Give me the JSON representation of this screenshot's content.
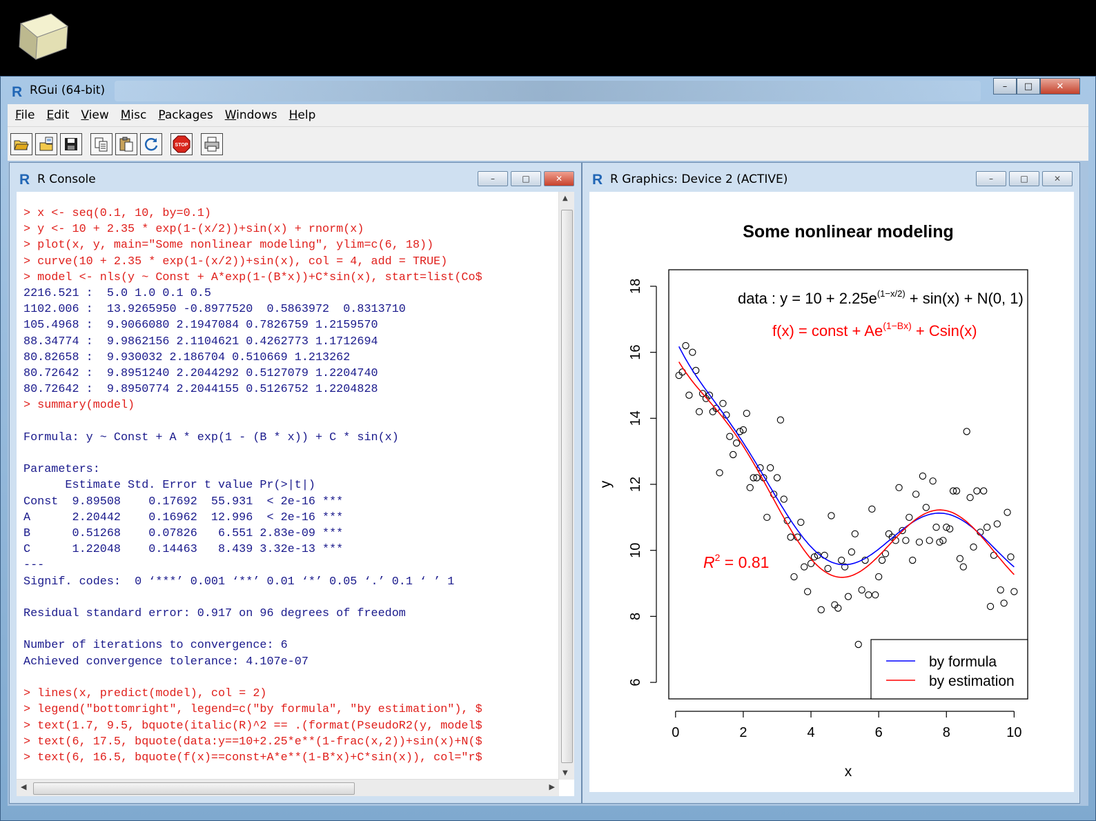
{
  "app": {
    "title": "RGui (64-bit)",
    "window_controls": {
      "minimize": "–",
      "maximize": "□",
      "close": "✕"
    }
  },
  "menu": [
    {
      "key": "F",
      "rest": "ile"
    },
    {
      "key": "E",
      "rest": "dit"
    },
    {
      "key": "V",
      "rest": "iew"
    },
    {
      "key": "M",
      "rest": "isc"
    },
    {
      "key": "P",
      "rest": "ackages"
    },
    {
      "key": "W",
      "rest": "indows"
    },
    {
      "key": "H",
      "rest": "elp"
    }
  ],
  "toolbar_icons": [
    "open-script-icon",
    "load-workspace-icon",
    "save-workspace-icon",
    "copy-icon",
    "paste-icon",
    "refresh-icon",
    "stop-icon",
    "print-icon"
  ],
  "console": {
    "title": "R Console",
    "lines": [
      {
        "t": "in",
        "s": "> x <- seq(0.1, 10, by=0.1)"
      },
      {
        "t": "in",
        "s": "> y <- 10 + 2.35 * exp(1-(x/2))+sin(x) + rnorm(x)"
      },
      {
        "t": "in",
        "s": "> plot(x, y, main=\"Some nonlinear modeling\", ylim=c(6, 18))"
      },
      {
        "t": "in",
        "s": "> curve(10 + 2.35 * exp(1-(x/2))+sin(x), col = 4, add = TRUE)"
      },
      {
        "t": "in",
        "s": "> model <- nls(y ~ Const + A*exp(1-(B*x))+C*sin(x), start=list(Co$"
      },
      {
        "t": "out",
        "s": "2216.521 :  5.0 1.0 0.1 0.5"
      },
      {
        "t": "out",
        "s": "1102.006 :  13.9265950 -0.8977520  0.5863972  0.8313710"
      },
      {
        "t": "out",
        "s": "105.4968 :  9.9066080 2.1947084 0.7826759 1.2159570"
      },
      {
        "t": "out",
        "s": "88.34774 :  9.9862156 2.1104621 0.4262773 1.1712694"
      },
      {
        "t": "out",
        "s": "80.82658 :  9.930032 2.186704 0.510669 1.213262"
      },
      {
        "t": "out",
        "s": "80.72642 :  9.8951240 2.2044292 0.5127079 1.2204740"
      },
      {
        "t": "out",
        "s": "80.72642 :  9.8950774 2.2044155 0.5126752 1.2204828"
      },
      {
        "t": "in",
        "s": "> summary(model)"
      },
      {
        "t": "out",
        "s": ""
      },
      {
        "t": "out",
        "s": "Formula: y ~ Const + A * exp(1 - (B * x)) + C * sin(x)"
      },
      {
        "t": "out",
        "s": ""
      },
      {
        "t": "out",
        "s": "Parameters:"
      },
      {
        "t": "out",
        "s": "      Estimate Std. Error t value Pr(>|t|)    "
      },
      {
        "t": "out",
        "s": "Const  9.89508    0.17692  55.931  < 2e-16 ***"
      },
      {
        "t": "out",
        "s": "A      2.20442    0.16962  12.996  < 2e-16 ***"
      },
      {
        "t": "out",
        "s": "B      0.51268    0.07826   6.551 2.83e-09 ***"
      },
      {
        "t": "out",
        "s": "C      1.22048    0.14463   8.439 3.32e-13 ***"
      },
      {
        "t": "out",
        "s": "---"
      },
      {
        "t": "out",
        "s": "Signif. codes:  0 ‘***’ 0.001 ‘**’ 0.01 ‘*’ 0.05 ‘.’ 0.1 ‘ ’ 1"
      },
      {
        "t": "out",
        "s": ""
      },
      {
        "t": "out",
        "s": "Residual standard error: 0.917 on 96 degrees of freedom"
      },
      {
        "t": "out",
        "s": ""
      },
      {
        "t": "out",
        "s": "Number of iterations to convergence: 6 "
      },
      {
        "t": "out",
        "s": "Achieved convergence tolerance: 4.107e-07"
      },
      {
        "t": "out",
        "s": ""
      },
      {
        "t": "in",
        "s": "> lines(x, predict(model), col = 2)"
      },
      {
        "t": "in",
        "s": "> legend(\"bottomright\", legend=c(\"by formula\", \"by estimation\"), $"
      },
      {
        "t": "in",
        "s": "> text(1.7, 9.5, bquote(italic(R)^2 == .(format(PseudoR2(y, model$"
      },
      {
        "t": "in",
        "s": "> text(6, 17.5, bquote(data:y==10+2.25*e**(1-frac(x,2))+sin(x)+N($"
      },
      {
        "t": "in",
        "s": "> text(6, 16.5, bquote(f(x)==const+A*e**(1-B*x)+C*sin(x)), col=\"r$"
      }
    ]
  },
  "graphics": {
    "title": "R Graphics: Device 2 (ACTIVE)"
  },
  "chart_data": {
    "type": "scatter",
    "title": "Some nonlinear modeling",
    "xlabel": "x",
    "ylabel": "y",
    "xlim": [
      0,
      10
    ],
    "ylim": [
      6,
      18
    ],
    "xticks": [
      "0",
      "2",
      "4",
      "6",
      "8",
      "10"
    ],
    "yticks": [
      "6",
      "8",
      "10",
      "12",
      "14",
      "16",
      "18"
    ],
    "annotations": {
      "data_formula": {
        "prefix": "data : y = 10 + 2.25e",
        "exponent": "(1−x/2)",
        "suffix": " + sin(x) + N(0, 1)"
      },
      "fit_formula": {
        "prefix": "f(x) = const + Ae",
        "exponent": "(1−Bx)",
        "suffix": " + Csin(x)"
      },
      "r2": {
        "label": "R",
        "power": "2",
        "value": " = 0.81"
      }
    },
    "legend": {
      "position": "bottom-right",
      "entries": [
        {
          "name": "by formula",
          "color": "#0000ff"
        },
        {
          "name": "by estimation",
          "color": "#ff0000"
        }
      ]
    },
    "curves": {
      "formula": {
        "Const": 10,
        "A": 2.35,
        "B": 0.5,
        "C": 1,
        "color": "#0000ff"
      },
      "estimation": {
        "Const": 9.89508,
        "A": 2.20442,
        "B": 0.51268,
        "C": 1.22048,
        "color": "#ff0000"
      }
    },
    "points": [
      [
        0.1,
        15.3
      ],
      [
        0.2,
        15.4
      ],
      [
        0.3,
        16.2
      ],
      [
        0.4,
        14.7
      ],
      [
        0.5,
        16.0
      ],
      [
        0.6,
        15.45
      ],
      [
        0.7,
        14.2
      ],
      [
        0.8,
        14.75
      ],
      [
        0.9,
        14.6
      ],
      [
        1.0,
        14.7
      ],
      [
        1.1,
        14.2
      ],
      [
        1.2,
        14.3
      ],
      [
        1.3,
        12.35
      ],
      [
        1.4,
        14.45
      ],
      [
        1.5,
        14.1
      ],
      [
        1.6,
        13.45
      ],
      [
        1.7,
        12.9
      ],
      [
        1.8,
        13.25
      ],
      [
        1.9,
        13.6
      ],
      [
        2.0,
        13.65
      ],
      [
        2.1,
        14.15
      ],
      [
        2.2,
        11.9
      ],
      [
        2.3,
        12.2
      ],
      [
        2.4,
        12.2
      ],
      [
        2.5,
        12.5
      ],
      [
        2.6,
        12.2
      ],
      [
        2.7,
        11.0
      ],
      [
        2.8,
        12.5
      ],
      [
        2.9,
        11.7
      ],
      [
        3.0,
        12.2
      ],
      [
        3.1,
        13.95
      ],
      [
        3.2,
        11.55
      ],
      [
        3.3,
        10.9
      ],
      [
        3.4,
        10.4
      ],
      [
        3.5,
        9.2
      ],
      [
        3.6,
        10.4
      ],
      [
        3.7,
        10.85
      ],
      [
        3.8,
        9.5
      ],
      [
        3.9,
        8.75
      ],
      [
        4.0,
        9.6
      ],
      [
        4.1,
        9.8
      ],
      [
        4.2,
        9.85
      ],
      [
        4.3,
        8.2
      ],
      [
        4.4,
        9.85
      ],
      [
        4.5,
        9.45
      ],
      [
        4.6,
        11.05
      ],
      [
        4.7,
        8.35
      ],
      [
        4.8,
        8.25
      ],
      [
        4.9,
        9.7
      ],
      [
        5.0,
        9.5
      ],
      [
        5.1,
        8.6
      ],
      [
        5.2,
        9.95
      ],
      [
        5.3,
        10.5
      ],
      [
        5.4,
        7.15
      ],
      [
        5.5,
        8.8
      ],
      [
        5.6,
        9.7
      ],
      [
        5.7,
        8.65
      ],
      [
        5.8,
        11.25
      ],
      [
        5.9,
        8.65
      ],
      [
        6.0,
        9.2
      ],
      [
        6.1,
        9.7
      ],
      [
        6.2,
        9.9
      ],
      [
        6.3,
        10.5
      ],
      [
        6.4,
        10.4
      ],
      [
        6.5,
        10.3
      ],
      [
        6.6,
        11.9
      ],
      [
        6.7,
        10.6
      ],
      [
        6.8,
        10.3
      ],
      [
        6.9,
        11.0
      ],
      [
        7.0,
        9.7
      ],
      [
        7.1,
        11.7
      ],
      [
        7.2,
        10.25
      ],
      [
        7.3,
        12.25
      ],
      [
        7.4,
        11.3
      ],
      [
        7.5,
        10.3
      ],
      [
        7.6,
        12.1
      ],
      [
        7.7,
        10.7
      ],
      [
        7.8,
        10.25
      ],
      [
        7.9,
        10.3
      ],
      [
        8.0,
        10.7
      ],
      [
        8.1,
        10.65
      ],
      [
        8.2,
        11.8
      ],
      [
        8.3,
        11.8
      ],
      [
        8.4,
        9.75
      ],
      [
        8.5,
        9.5
      ],
      [
        8.6,
        13.6
      ],
      [
        8.7,
        11.6
      ],
      [
        8.8,
        10.1
      ],
      [
        8.9,
        11.8
      ],
      [
        9.0,
        10.55
      ],
      [
        9.1,
        11.8
      ],
      [
        9.2,
        10.7
      ],
      [
        9.3,
        8.3
      ],
      [
        9.4,
        9.85
      ],
      [
        9.5,
        10.8
      ],
      [
        9.6,
        8.8
      ],
      [
        9.7,
        8.4
      ],
      [
        9.8,
        11.15
      ],
      [
        9.9,
        9.8
      ],
      [
        10.0,
        8.75
      ]
    ]
  }
}
